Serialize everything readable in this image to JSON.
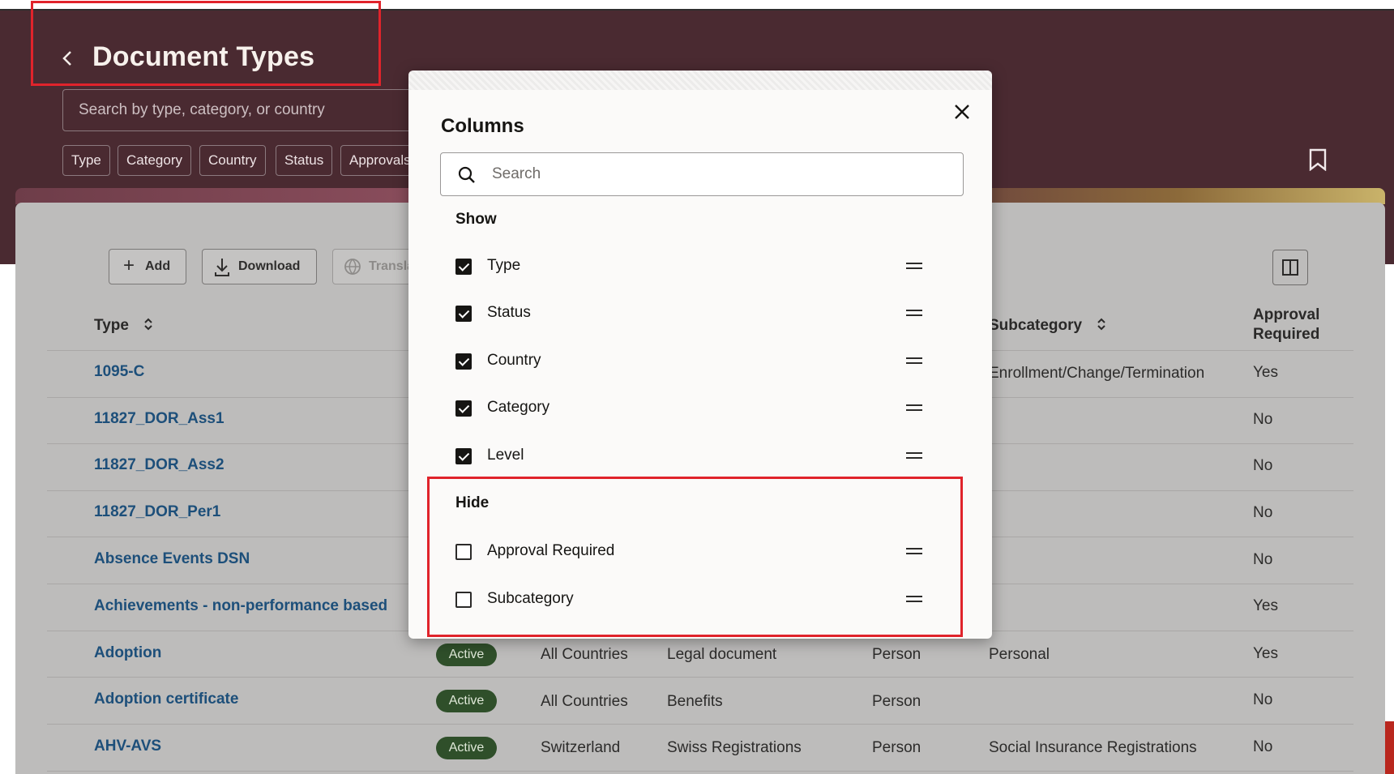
{
  "header": {
    "title": "Document Types",
    "search_placeholder": "Search by type, category, or country",
    "filters": [
      "Type",
      "Category",
      "Country",
      "Status",
      "Approvals"
    ]
  },
  "toolbar": {
    "add_label": "Add",
    "download_label": "Download",
    "translate_label": "Transla"
  },
  "table": {
    "headers": {
      "type": "Type",
      "subcategory": "Subcategory",
      "approval_line1": "Approval",
      "approval_line2": "Required"
    },
    "rows": [
      {
        "type": "1095-C",
        "status": "",
        "country": "",
        "category": "",
        "level": "",
        "subcategory": "Enrollment/Change/Termination",
        "approval": "Yes"
      },
      {
        "type": "11827_DOR_Ass1",
        "status": "",
        "country": "",
        "category": "",
        "level": "",
        "subcategory": "",
        "approval": "No"
      },
      {
        "type": "11827_DOR_Ass2",
        "status": "",
        "country": "",
        "category": "",
        "level": "",
        "subcategory": "",
        "approval": "No"
      },
      {
        "type": "11827_DOR_Per1",
        "status": "",
        "country": "",
        "category": "",
        "level": "",
        "subcategory": "",
        "approval": "No"
      },
      {
        "type": "Absence Events DSN",
        "status": "",
        "country": "",
        "category": "",
        "level": "",
        "subcategory": "",
        "approval": "No"
      },
      {
        "type": "Achievements - non-performance based",
        "status": "",
        "country": "",
        "category": "",
        "level": "",
        "subcategory": "",
        "approval": "Yes"
      },
      {
        "type": "Adoption",
        "status": "Active",
        "country": "All Countries",
        "category": "Legal document",
        "level": "Person",
        "subcategory": "Personal",
        "approval": "Yes"
      },
      {
        "type": "Adoption certificate",
        "status": "Active",
        "country": "All Countries",
        "category": "Benefits",
        "level": "Person",
        "subcategory": "",
        "approval": "No"
      },
      {
        "type": "AHV-AVS",
        "status": "Active",
        "country": "Switzerland",
        "category": "Swiss Registrations",
        "level": "Person",
        "subcategory": "Social Insurance Registrations",
        "approval": "No"
      }
    ]
  },
  "dialog": {
    "title": "Columns",
    "search_placeholder": "Search",
    "show_heading": "Show",
    "hide_heading": "Hide",
    "shown": [
      "Type",
      "Status",
      "Country",
      "Category",
      "Level"
    ],
    "hidden": [
      "Approval Required",
      "Subcategory"
    ]
  },
  "colors": {
    "header_bg": "#4a2a31",
    "link": "#1d4f7a",
    "highlight": "#e0232b",
    "badge_bg": "#2f4f2a"
  }
}
